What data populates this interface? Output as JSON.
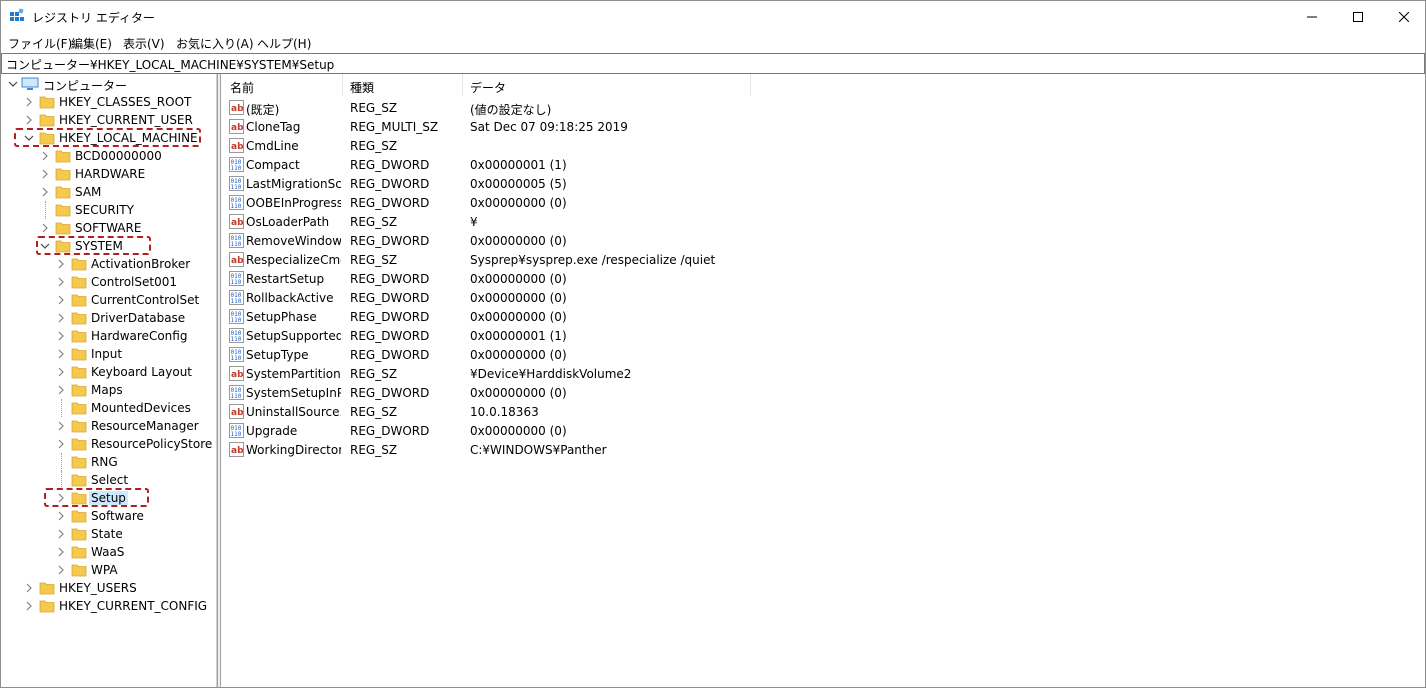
{
  "window": {
    "title": "レジストリ エディター",
    "controls": {
      "minimize": "minimize-icon",
      "maximize": "maximize-icon",
      "close": "close-icon"
    }
  },
  "menu": [
    "ファイル(F)",
    "編集(E)",
    "表示(V)",
    "お気に入り(A)",
    "ヘルプ(H)"
  ],
  "address": "コンピューター¥HKEY_LOCAL_MACHINE¥SYSTEM¥Setup",
  "tree": {
    "root": "コンピューター",
    "items": [
      {
        "label": "HKEY_CLASSES_ROOT",
        "level": 1,
        "chevron": "right"
      },
      {
        "label": "HKEY_CURRENT_USER",
        "level": 1,
        "chevron": "right"
      },
      {
        "label": "HKEY_LOCAL_MACHINE",
        "level": 1,
        "chevron": "down",
        "highlight": true
      },
      {
        "label": "BCD00000000",
        "level": 2,
        "chevron": "right"
      },
      {
        "label": "HARDWARE",
        "level": 2,
        "chevron": "right"
      },
      {
        "label": "SAM",
        "level": 2,
        "chevron": "right"
      },
      {
        "label": "SECURITY",
        "level": 2,
        "chevron": "none"
      },
      {
        "label": "SOFTWARE",
        "level": 2,
        "chevron": "right"
      },
      {
        "label": "SYSTEM",
        "level": 2,
        "chevron": "down",
        "highlight": true
      },
      {
        "label": "ActivationBroker",
        "level": 3,
        "chevron": "right"
      },
      {
        "label": "ControlSet001",
        "level": 3,
        "chevron": "right"
      },
      {
        "label": "CurrentControlSet",
        "level": 3,
        "chevron": "right"
      },
      {
        "label": "DriverDatabase",
        "level": 3,
        "chevron": "right"
      },
      {
        "label": "HardwareConfig",
        "level": 3,
        "chevron": "right"
      },
      {
        "label": "Input",
        "level": 3,
        "chevron": "right"
      },
      {
        "label": "Keyboard Layout",
        "level": 3,
        "chevron": "right"
      },
      {
        "label": "Maps",
        "level": 3,
        "chevron": "right"
      },
      {
        "label": "MountedDevices",
        "level": 3,
        "chevron": "none"
      },
      {
        "label": "ResourceManager",
        "level": 3,
        "chevron": "right"
      },
      {
        "label": "ResourcePolicyStore",
        "level": 3,
        "chevron": "right"
      },
      {
        "label": "RNG",
        "level": 3,
        "chevron": "none"
      },
      {
        "label": "Select",
        "level": 3,
        "chevron": "none"
      },
      {
        "label": "Setup",
        "level": 3,
        "chevron": "right",
        "selected": true,
        "highlight": true
      },
      {
        "label": "Software",
        "level": 3,
        "chevron": "right"
      },
      {
        "label": "State",
        "level": 3,
        "chevron": "right"
      },
      {
        "label": "WaaS",
        "level": 3,
        "chevron": "right"
      },
      {
        "label": "WPA",
        "level": 3,
        "chevron": "right"
      },
      {
        "label": "HKEY_USERS",
        "level": 1,
        "chevron": "right"
      },
      {
        "label": "HKEY_CURRENT_CONFIG",
        "level": 1,
        "chevron": "right"
      }
    ]
  },
  "list": {
    "headers": [
      "名前",
      "種類",
      "データ"
    ],
    "rows": [
      {
        "icon": "string",
        "name": "(既定)",
        "type": "REG_SZ",
        "data": "(値の設定なし)"
      },
      {
        "icon": "string",
        "name": "CloneTag",
        "type": "REG_MULTI_SZ",
        "data": "Sat Dec 07 09:18:25 2019"
      },
      {
        "icon": "string",
        "name": "CmdLine",
        "type": "REG_SZ",
        "data": ""
      },
      {
        "icon": "binary",
        "name": "Compact",
        "type": "REG_DWORD",
        "data": "0x00000001 (1)"
      },
      {
        "icon": "binary",
        "name": "LastMigrationSc...",
        "type": "REG_DWORD",
        "data": "0x00000005 (5)"
      },
      {
        "icon": "binary",
        "name": "OOBEInProgress",
        "type": "REG_DWORD",
        "data": "0x00000000 (0)"
      },
      {
        "icon": "string",
        "name": "OsLoaderPath",
        "type": "REG_SZ",
        "data": "¥"
      },
      {
        "icon": "binary",
        "name": "RemoveWindow...",
        "type": "REG_DWORD",
        "data": "0x00000000 (0)"
      },
      {
        "icon": "string",
        "name": "RespecializeCmd...",
        "type": "REG_SZ",
        "data": "Sysprep¥sysprep.exe /respecialize /quiet"
      },
      {
        "icon": "binary",
        "name": "RestartSetup",
        "type": "REG_DWORD",
        "data": "0x00000000 (0)"
      },
      {
        "icon": "binary",
        "name": "RollbackActive",
        "type": "REG_DWORD",
        "data": "0x00000000 (0)"
      },
      {
        "icon": "binary",
        "name": "SetupPhase",
        "type": "REG_DWORD",
        "data": "0x00000000 (0)"
      },
      {
        "icon": "binary",
        "name": "SetupSupported",
        "type": "REG_DWORD",
        "data": "0x00000001 (1)"
      },
      {
        "icon": "binary",
        "name": "SetupType",
        "type": "REG_DWORD",
        "data": "0x00000000 (0)"
      },
      {
        "icon": "string",
        "name": "SystemPartition",
        "type": "REG_SZ",
        "data": "¥Device¥HarddiskVolume2"
      },
      {
        "icon": "binary",
        "name": "SystemSetupInP...",
        "type": "REG_DWORD",
        "data": "0x00000000 (0)"
      },
      {
        "icon": "string",
        "name": "UninstallSource...",
        "type": "REG_SZ",
        "data": "10.0.18363"
      },
      {
        "icon": "binary",
        "name": "Upgrade",
        "type": "REG_DWORD",
        "data": "0x00000000 (0)"
      },
      {
        "icon": "string",
        "name": "WorkingDirectory",
        "type": "REG_SZ",
        "data": "C:¥WINDOWS¥Panther"
      }
    ]
  },
  "colors": {
    "highlight": "#b02020",
    "selection": "#cce8ff",
    "folder": "#f5c94b",
    "string_icon": "#c0392b",
    "binary_icon": "#1f5fbf"
  }
}
